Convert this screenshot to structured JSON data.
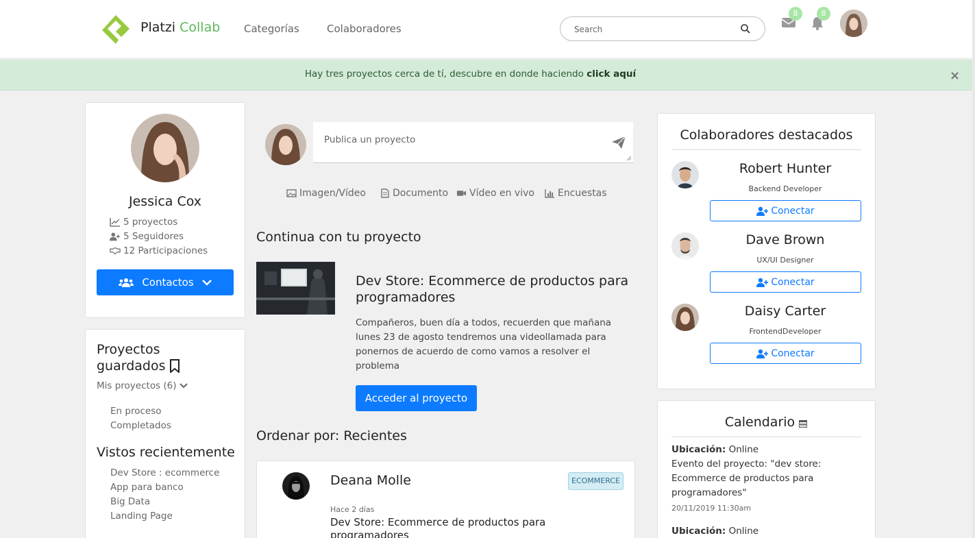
{
  "brand": {
    "name": "Platzi",
    "accent": "Collab"
  },
  "nav": {
    "categories": "Categorías",
    "collaborators": "Colaboradores"
  },
  "search": {
    "placeholder": "Search"
  },
  "notifications": {
    "messages_count": "8",
    "alerts_count": "8"
  },
  "banner": {
    "text": "Hay tres proyectos cerca de tí, descubre en donde haciendo ",
    "link": "click aquí",
    "close": "×"
  },
  "profile": {
    "name": "Jessica Cox",
    "stats": {
      "projects": "5 proyectos",
      "followers": "5 Seguidores",
      "participations": "12 Participaciones"
    },
    "contacts_button": "Contactos"
  },
  "saved": {
    "title_line1": "Proyectos",
    "title_line2": "guardados",
    "my_projects": "Mis proyectos (6)",
    "items": [
      "En proceso",
      "Completados"
    ],
    "recent_title": "Vistos recientemente",
    "recent": [
      "Dev Store : ecommerce",
      "App para banco",
      "Big Data",
      "Landing Page"
    ]
  },
  "publish": {
    "placeholder": "Publica un proyecto",
    "options": [
      "Imagen/Vídeo",
      "Documento",
      "Vídeo en vivo",
      "Encuestas"
    ]
  },
  "continue": {
    "title": "Continua con tu proyecto",
    "project_title_line1": "Dev Store: Ecommerce de productos para",
    "project_title_line2": "programadores",
    "description": [
      "Compañeros, buen día a todos, recuerden que mañana",
      "lunes 23 de agosto tendremos una videollamada para",
      "ponernos de acuerdo de como vamos a resolver el",
      "problema"
    ],
    "button": "Acceder al proyecto"
  },
  "sort": {
    "label": "Ordenar por: Recientes"
  },
  "post": {
    "author": "Deana Molle",
    "tag": "ECOMMERCE",
    "time": "Hace 2 días",
    "title_line1": "Dev Store: Ecommerce de productos para",
    "title_line2": "programadores"
  },
  "featured": {
    "title": "Colaboradores destacados",
    "connect_label": "Conectar",
    "people": [
      {
        "name": "Robert Hunter",
        "role": "Backend Developer"
      },
      {
        "name": "Dave Brown",
        "role": "UX/UI Designer"
      },
      {
        "name": "Daisy Carter",
        "role": "FrontendDeveloper"
      }
    ]
  },
  "calendar": {
    "title": "Calendario",
    "events": [
      {
        "location_label": "Ubicación:",
        "location": " Online",
        "desc": [
          "Evento del proyecto: \"dev store:",
          "Ecommerce de productos para",
          "programadores\""
        ],
        "date": "20/11/2019 11:30am"
      },
      {
        "location_label": "Ubicación:",
        "location": " Online"
      }
    ]
  },
  "colors": {
    "brand_green": "#5cb85c",
    "primary": "#0d7bff",
    "banner_bg": "#d4ebd8"
  }
}
